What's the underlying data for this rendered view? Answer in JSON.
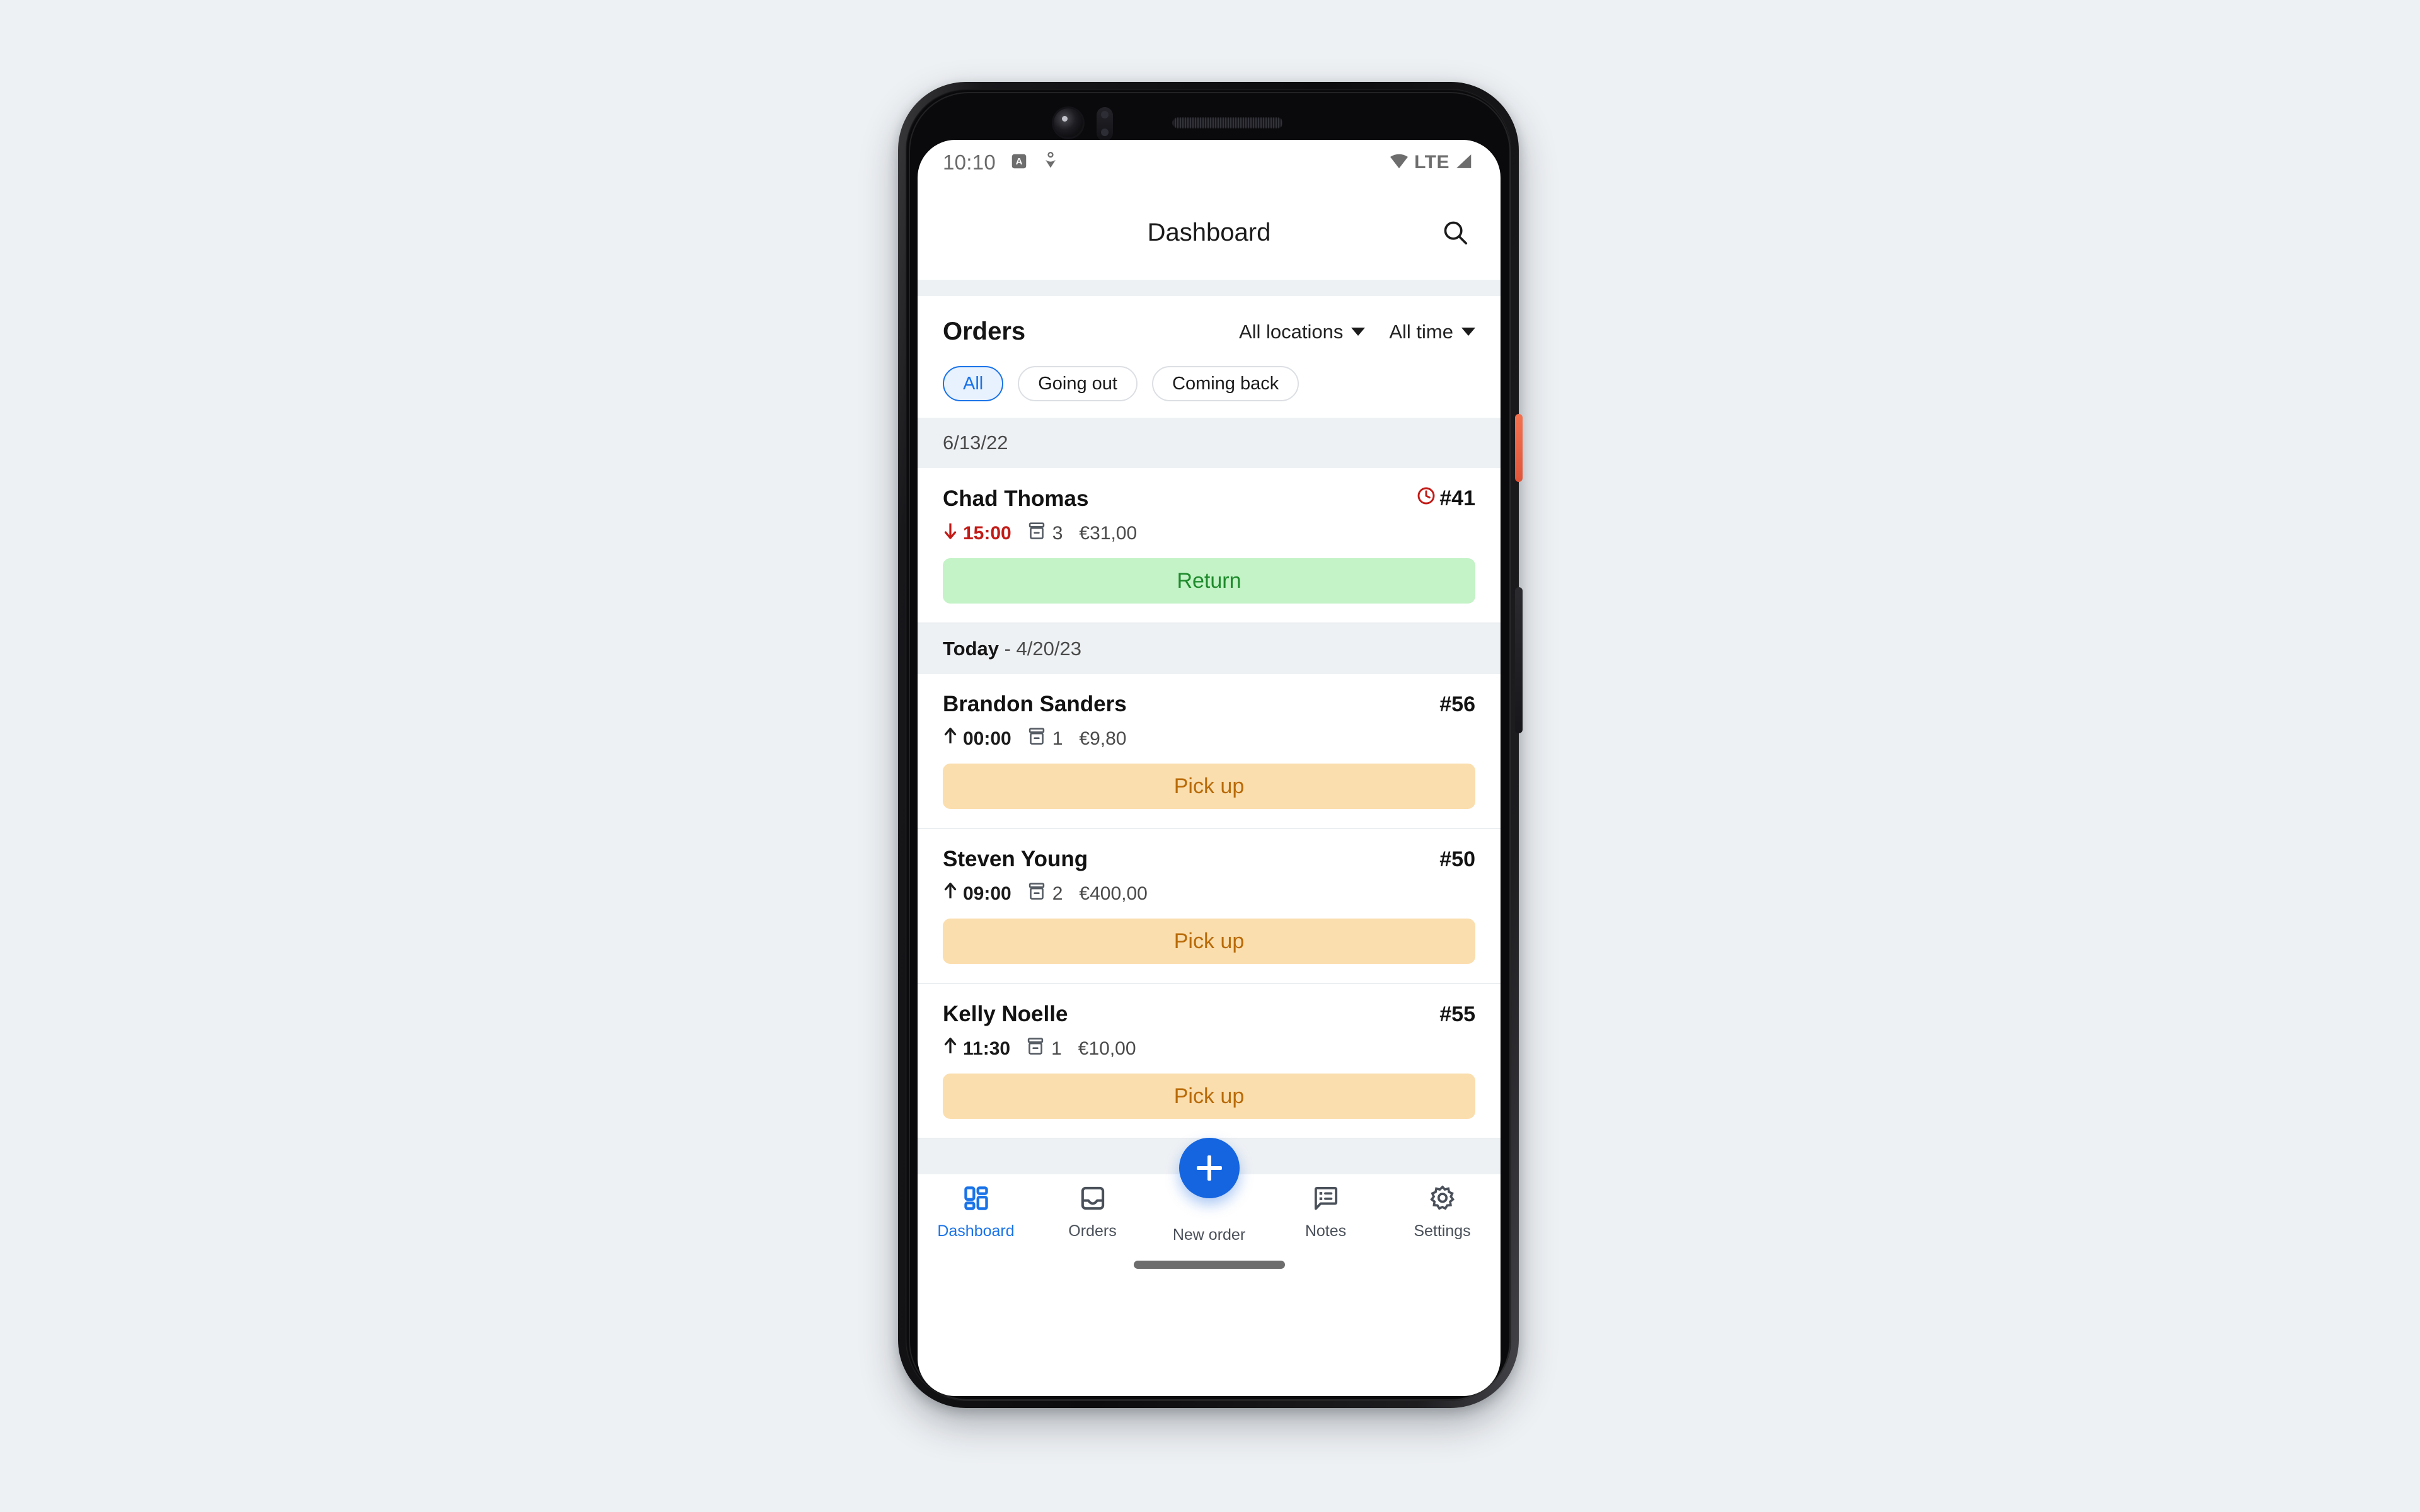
{
  "status_bar": {
    "time": "10:10",
    "icons_left": [
      "alarm-a-badge-icon",
      "location-person-icon"
    ],
    "network_label": "LTE",
    "icons_right": [
      "wifi-icon",
      "cellular-signal-icon"
    ]
  },
  "app_bar": {
    "title": "Dashboard",
    "search_icon": "search-icon"
  },
  "orders_section": {
    "title": "Orders",
    "location_filter": "All locations",
    "time_filter": "All time",
    "chips": [
      {
        "label": "All",
        "active": true
      },
      {
        "label": "Going out",
        "active": false
      },
      {
        "label": "Coming back",
        "active": false
      }
    ]
  },
  "groups": [
    {
      "header_strong": "",
      "header_date": "6/13/22",
      "orders": [
        {
          "name": "Chad Thomas",
          "id": "#41",
          "overdue_icon": "clock-icon",
          "overdue": true,
          "direction": "down",
          "time": "15:00",
          "package_icon": "package-box-icon",
          "package_count": "3",
          "price": "€31,00",
          "action_label": "Return",
          "action_type": "return"
        }
      ]
    },
    {
      "header_strong": "Today",
      "header_date": "- 4/20/23",
      "orders": [
        {
          "name": "Brandon Sanders",
          "id": "#56",
          "overdue": false,
          "direction": "up",
          "time": "00:00",
          "package_icon": "package-box-icon",
          "package_count": "1",
          "price": "€9,80",
          "action_label": "Pick up",
          "action_type": "pickup"
        },
        {
          "name": "Steven Young",
          "id": "#50",
          "overdue": false,
          "direction": "up",
          "time": "09:00",
          "package_icon": "package-box-icon",
          "package_count": "2",
          "price": "€400,00",
          "action_label": "Pick up",
          "action_type": "pickup"
        },
        {
          "name": "Kelly Noelle",
          "id": "#55",
          "overdue": false,
          "direction": "up",
          "time": "11:30",
          "package_icon": "package-box-icon",
          "package_count": "1",
          "price": "€10,00",
          "action_label": "Pick up",
          "action_type": "pickup"
        }
      ]
    }
  ],
  "fab": {
    "label": "New order",
    "icon": "plus-icon"
  },
  "nav": [
    {
      "label": "Dashboard",
      "icon": "dashboard-grid-icon",
      "active": true
    },
    {
      "label": "Orders",
      "icon": "inbox-tray-icon",
      "active": false
    },
    {
      "label": "Notes",
      "icon": "speech-bubble-list-icon",
      "active": false
    },
    {
      "label": "Settings",
      "icon": "gear-icon",
      "active": false
    }
  ],
  "colors": {
    "accent_blue": "#1a73e8",
    "fab_blue": "#1565e0",
    "return_bg": "#c3f3c6",
    "return_text": "#1e8a2c",
    "pickup_bg": "#fbdeae",
    "pickup_text": "#b96b08",
    "overdue_red": "#c21b17",
    "page_bg": "#eef1f4"
  }
}
